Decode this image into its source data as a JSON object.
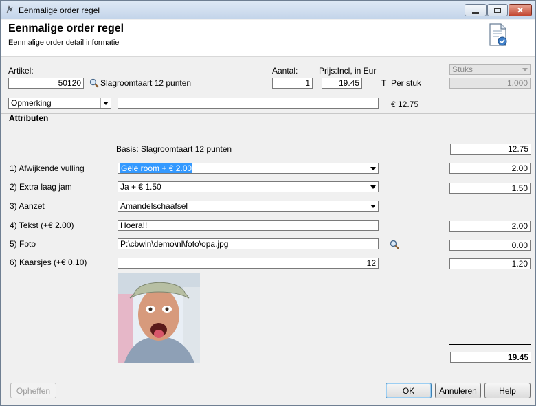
{
  "window": {
    "title": "Eenmalige order regel",
    "minimize_icon": "minimize-icon",
    "maximize_icon": "maximize-icon",
    "close_icon": "close-icon"
  },
  "header": {
    "title": "Eenmalige order regel",
    "subtitle": "Eenmalige order detail informatie",
    "icon": "document-icon"
  },
  "order": {
    "artikel_label": "Artikel:",
    "artikel_value": "50120",
    "artikel_name": "Slagroomtaart 12 punten",
    "aantal_label": "Aantal:",
    "aantal_value": "1",
    "prijs_label": "Prijs:Incl, in Eur",
    "prijs_value": "19.45",
    "t_label": "T",
    "per_stuk_label": "Per stuk",
    "unit_select": "Stuks",
    "unit_value": "1.000",
    "opmerking_select": "Opmerking",
    "opmerking_value": "",
    "price_each": "€ 12.75"
  },
  "attributes": {
    "section_title": "Attributen",
    "basis_label": "Basis: Slagroomtaart 12 punten",
    "basis_price": "12.75",
    "rows": [
      {
        "label": "1) Afwijkende vulling",
        "value": "Gele room + € 2.00",
        "price": "2.00"
      },
      {
        "label": "2) Extra laag jam",
        "value": "Ja + € 1.50",
        "price": "1.50"
      },
      {
        "label": "3) Aanzet",
        "value": "Amandelschaafsel",
        "price": ""
      },
      {
        "label": "4) Tekst (+€ 2.00)",
        "value": "Hoera!!",
        "price": "2.00"
      },
      {
        "label": "5) Foto",
        "value": "P:\\cbwin\\demo\\nl\\foto\\opa.jpg",
        "price": "0.00"
      },
      {
        "label": "6) Kaarsjes (+€ 0.10)",
        "value": "12",
        "price": "1.20"
      }
    ],
    "total": "19.45"
  },
  "buttons": {
    "opheffen": "Opheffen",
    "ok": "OK",
    "annuleren": "Annuleren",
    "help": "Help"
  }
}
